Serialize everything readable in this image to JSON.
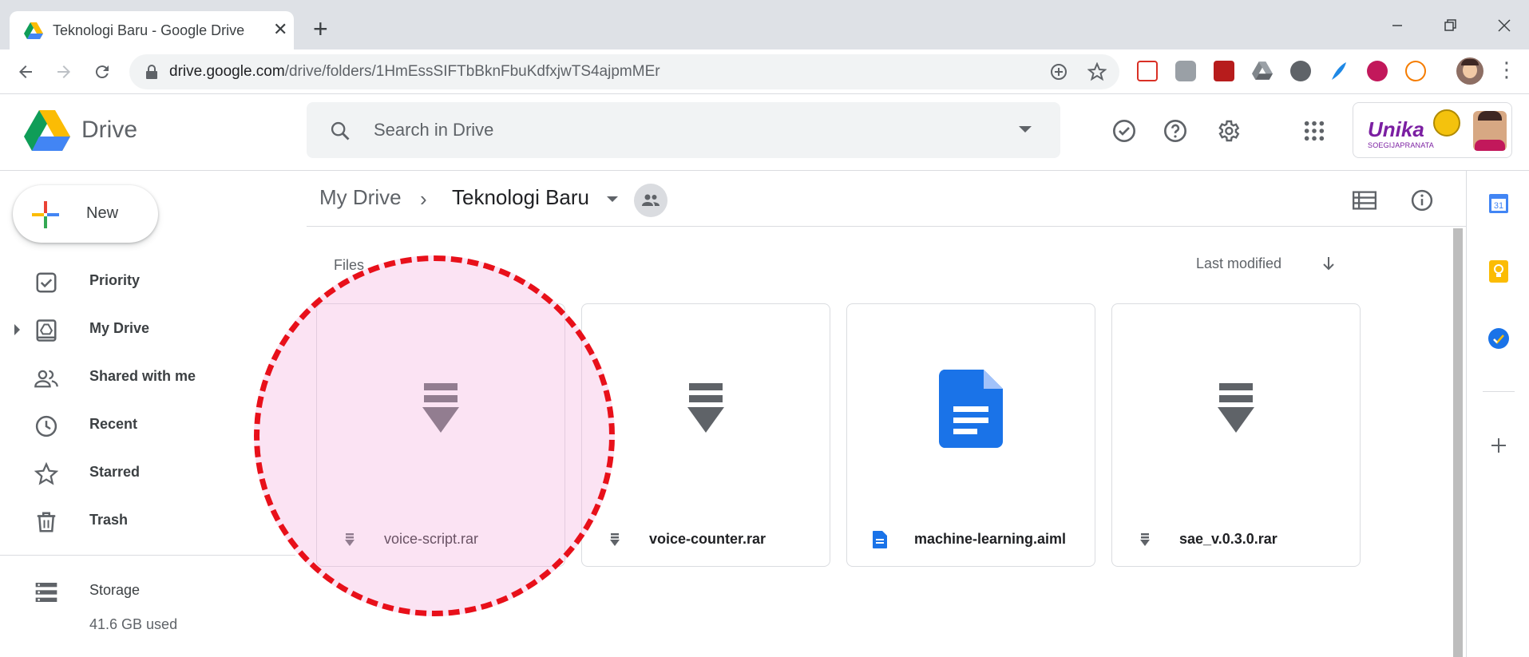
{
  "browser": {
    "tab_title": "Teknologi Baru - Google Drive",
    "url_host": "drive.google.com",
    "url_path": "/drive/folders/1HmEssSIFTbBknFbuKdfxjwTS4ajpmMEr"
  },
  "header": {
    "logo_text": "Drive",
    "search_placeholder": "Search in Drive",
    "account_brand": "Unika",
    "account_brand_sub": "SOEGIJAPRANATA"
  },
  "sidebar": {
    "new_label": "New",
    "items": [
      {
        "label": "Priority",
        "icon": "priority-icon"
      },
      {
        "label": "My Drive",
        "icon": "my-drive-icon"
      },
      {
        "label": "Shared with me",
        "icon": "shared-icon"
      },
      {
        "label": "Recent",
        "icon": "clock-icon"
      },
      {
        "label": "Starred",
        "icon": "star-icon"
      },
      {
        "label": "Trash",
        "icon": "trash-icon"
      }
    ],
    "storage_label": "Storage",
    "storage_used": "41.6 GB used"
  },
  "breadcrumb": {
    "root": "My Drive",
    "separator": "›",
    "current": "Teknologi Baru"
  },
  "main": {
    "section_label": "Files",
    "sort_label": "Last modified",
    "files": [
      {
        "name": "voice-script.rar",
        "type": "archive"
      },
      {
        "name": "voice-counter.rar",
        "type": "archive"
      },
      {
        "name": "machine-learning.aiml",
        "type": "document"
      },
      {
        "name": "sae_v.0.3.0.rar",
        "type": "archive"
      }
    ]
  },
  "rail": {
    "calendar_day": "31"
  },
  "colors": {
    "doc_blue": "#1a73e8",
    "archive_gray": "#5f6368",
    "highlight_red": "#e8101a",
    "highlight_fill": "#f3aede"
  }
}
